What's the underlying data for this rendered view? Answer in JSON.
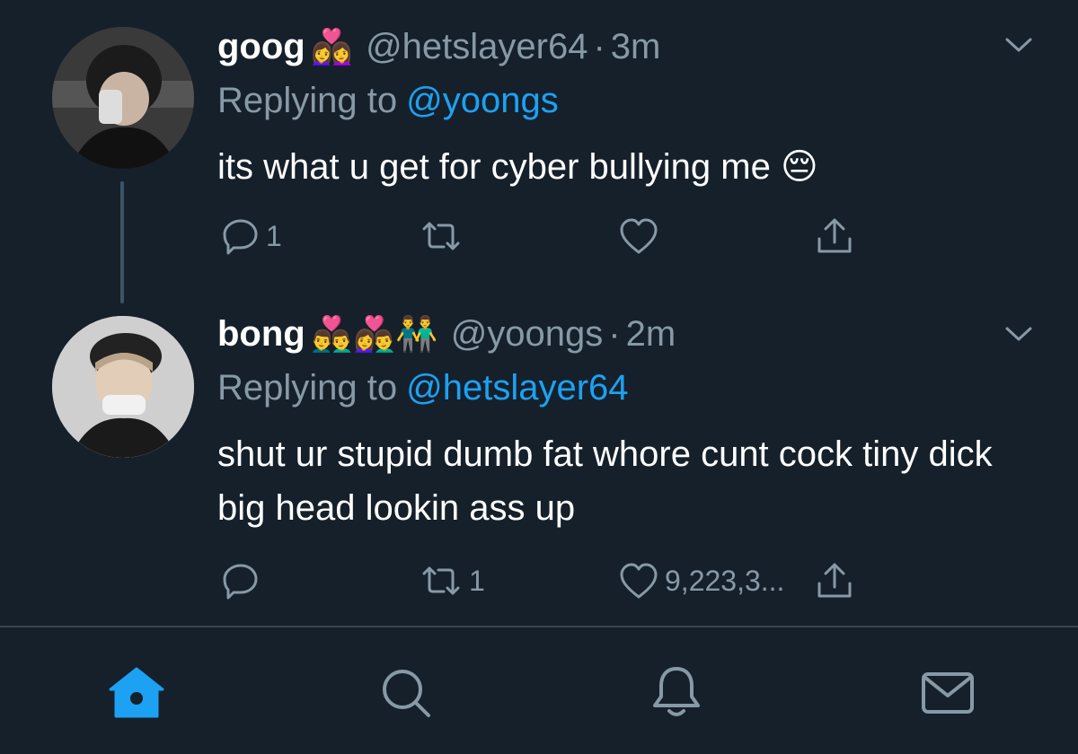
{
  "tweets": [
    {
      "name": "goog",
      "emoji": "👩‍❤️‍👩",
      "handle": "@hetslayer64",
      "dot": "·",
      "time": "3m",
      "replying_prefix": "Replying to",
      "replying_to": "@yoongs",
      "body": "its what u get for cyber bullying me 😔",
      "reply_count": "1",
      "retweet_count": "",
      "like_count": ""
    },
    {
      "name": "bong",
      "emoji": "👨‍❤️‍👨👩‍❤️‍👨👬",
      "handle": "@yoongs",
      "dot": "·",
      "time": "2m",
      "replying_prefix": "Replying to",
      "replying_to": "@hetslayer64",
      "body": "shut ur stupid dumb fat whore cunt cock tiny dick big head lookin ass up",
      "reply_count": "",
      "retweet_count": "1",
      "like_count": "9,223,3..."
    }
  ],
  "icons": {
    "reply": "reply-icon",
    "retweet": "retweet-icon",
    "like": "heart-icon",
    "share": "share-icon",
    "chevron": "chevron-down-icon"
  },
  "tabs": [
    {
      "name": "home",
      "icon": "home-icon",
      "active": true
    },
    {
      "name": "search",
      "icon": "search-icon",
      "active": false
    },
    {
      "name": "notifications",
      "icon": "bell-icon",
      "active": false
    },
    {
      "name": "messages",
      "icon": "mail-icon",
      "active": false
    }
  ],
  "colors": {
    "background": "#15202b",
    "accent": "#1da1f2",
    "muted": "#8899a6",
    "divider": "#38444d"
  }
}
